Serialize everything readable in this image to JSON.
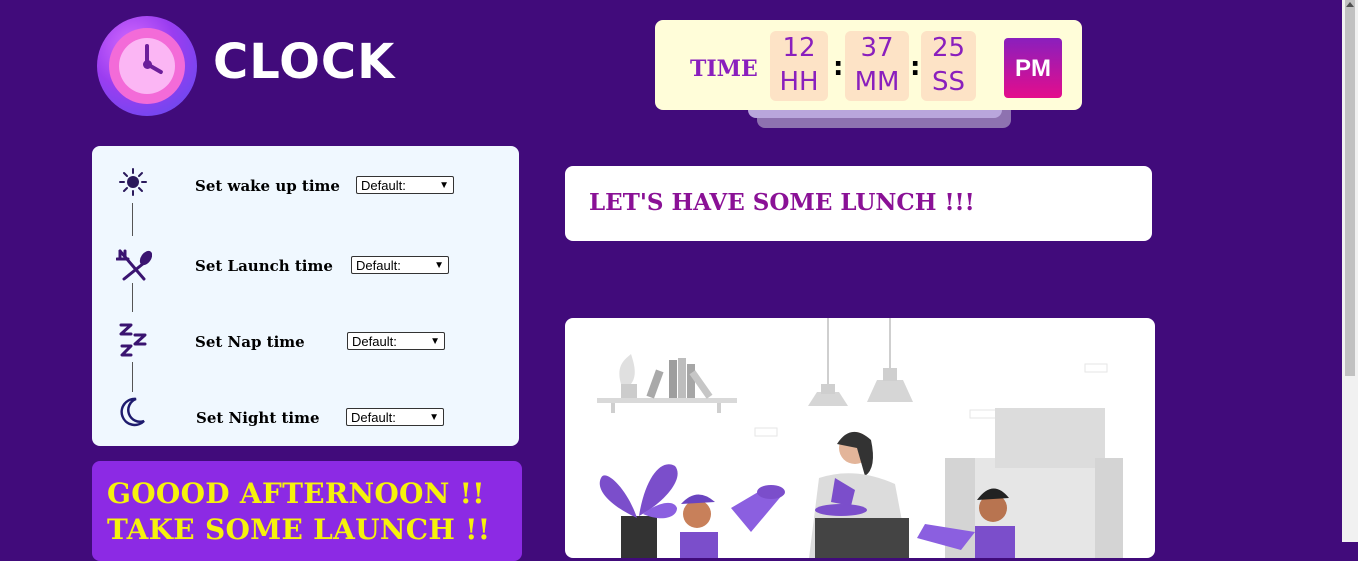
{
  "logo": {
    "title": "CLOCK"
  },
  "time": {
    "label": "TIME",
    "hours": "12",
    "hours_unit": "HH",
    "minutes": "37",
    "minutes_unit": "MM",
    "seconds": "25",
    "seconds_unit": "SS",
    "separator": ":",
    "ampm": "PM"
  },
  "alarms": [
    {
      "icon": "sun-icon",
      "label": "Set wake up time",
      "value": "Default:"
    },
    {
      "icon": "fork-spoon-icon",
      "label": "Set Launch time",
      "value": "Default:"
    },
    {
      "icon": "sleep-zzz-icon",
      "label": "Set Nap time",
      "value": "Default:"
    },
    {
      "icon": "moon-icon",
      "label": "Set Night time",
      "value": "Default:"
    }
  ],
  "greeting": {
    "line1": "GOOOD AFTERNOON !!",
    "line2": "TAKE SOME LAUNCH !!"
  },
  "message": "LET'S HAVE SOME LUNCH !!!",
  "colors": {
    "background": "#410b7b",
    "accent": "#8a1fbd",
    "greeting_text": "#f6f20c",
    "panel": "#f0f8ff"
  }
}
